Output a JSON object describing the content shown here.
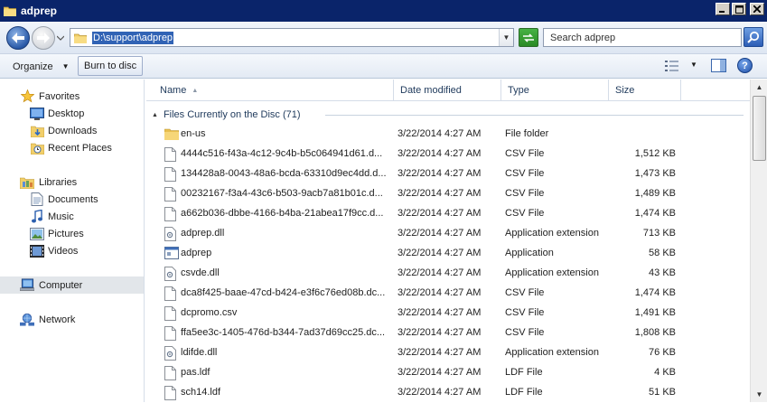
{
  "window": {
    "title": "adprep"
  },
  "address": {
    "path": "D:\\support\\adprep"
  },
  "search": {
    "placeholder": "Search adprep"
  },
  "toolbar": {
    "organize_label": "Organize",
    "burn_label": "Burn to disc"
  },
  "nav": {
    "favorites": {
      "label": "Favorites",
      "items": [
        "Desktop",
        "Downloads",
        "Recent Places"
      ]
    },
    "libraries": {
      "label": "Libraries",
      "items": [
        "Documents",
        "Music",
        "Pictures",
        "Videos"
      ]
    },
    "computer": "Computer",
    "network": "Network"
  },
  "columns": {
    "name": "Name",
    "date": "Date modified",
    "type": "Type",
    "size": "Size"
  },
  "group": {
    "label": "Files Currently on the Disc (71)"
  },
  "files": [
    {
      "name": "en-us",
      "date": "3/22/2014 4:27 AM",
      "type": "File folder",
      "size": "",
      "icon": "folder-icon"
    },
    {
      "name": "4444c516-f43a-4c12-9c4b-b5c064941d61.d...",
      "date": "3/22/2014 4:27 AM",
      "type": "CSV File",
      "size": "1,512 KB",
      "icon": "file-icon"
    },
    {
      "name": "134428a8-0043-48a6-bcda-63310d9ec4dd.d...",
      "date": "3/22/2014 4:27 AM",
      "type": "CSV File",
      "size": "1,473 KB",
      "icon": "file-icon"
    },
    {
      "name": "00232167-f3a4-43c6-b503-9acb7a81b01c.d...",
      "date": "3/22/2014 4:27 AM",
      "type": "CSV File",
      "size": "1,489 KB",
      "icon": "file-icon"
    },
    {
      "name": "a662b036-dbbe-4166-b4ba-21abea17f9cc.d...",
      "date": "3/22/2014 4:27 AM",
      "type": "CSV File",
      "size": "1,474 KB",
      "icon": "file-icon"
    },
    {
      "name": "adprep.dll",
      "date": "3/22/2014 4:27 AM",
      "type": "Application extension",
      "size": "713 KB",
      "icon": "dll-icon"
    },
    {
      "name": "adprep",
      "date": "3/22/2014 4:27 AM",
      "type": "Application",
      "size": "58 KB",
      "icon": "application-icon"
    },
    {
      "name": "csvde.dll",
      "date": "3/22/2014 4:27 AM",
      "type": "Application extension",
      "size": "43 KB",
      "icon": "dll-icon"
    },
    {
      "name": "dca8f425-baae-47cd-b424-e3f6c76ed08b.dc...",
      "date": "3/22/2014 4:27 AM",
      "type": "CSV File",
      "size": "1,474 KB",
      "icon": "file-icon"
    },
    {
      "name": "dcpromo.csv",
      "date": "3/22/2014 4:27 AM",
      "type": "CSV File",
      "size": "1,491 KB",
      "icon": "file-icon"
    },
    {
      "name": "ffa5ee3c-1405-476d-b344-7ad37d69cc25.dc...",
      "date": "3/22/2014 4:27 AM",
      "type": "CSV File",
      "size": "1,808 KB",
      "icon": "file-icon"
    },
    {
      "name": "ldifde.dll",
      "date": "3/22/2014 4:27 AM",
      "type": "Application extension",
      "size": "76 KB",
      "icon": "dll-icon"
    },
    {
      "name": "pas.ldf",
      "date": "3/22/2014 4:27 AM",
      "type": "LDF File",
      "size": "4 KB",
      "icon": "file-icon"
    },
    {
      "name": "sch14.ldf",
      "date": "3/22/2014 4:27 AM",
      "type": "LDF File",
      "size": "51 KB",
      "icon": "file-icon"
    }
  ]
}
